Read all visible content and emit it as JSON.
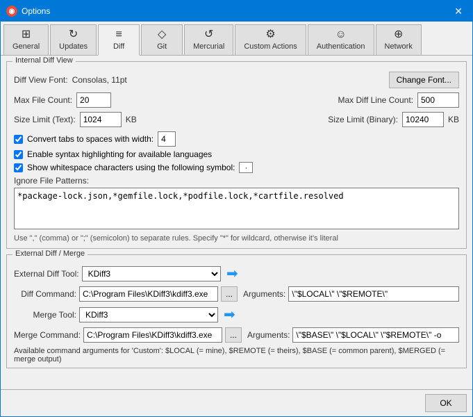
{
  "window": {
    "title": "Options",
    "icon": "◉",
    "close_label": "✕"
  },
  "tabs": [
    {
      "id": "general",
      "label": "General",
      "icon": "⊞",
      "active": false
    },
    {
      "id": "updates",
      "label": "Updates",
      "icon": "↻",
      "active": false
    },
    {
      "id": "diff",
      "label": "Diff",
      "icon": "≡",
      "active": true
    },
    {
      "id": "git",
      "label": "Git",
      "icon": "◇",
      "active": false
    },
    {
      "id": "mercurial",
      "label": "Mercurial",
      "icon": "↺",
      "active": false
    },
    {
      "id": "custom-actions",
      "label": "Custom Actions",
      "icon": "⚙",
      "active": false
    },
    {
      "id": "authentication",
      "label": "Authentication",
      "icon": "☺",
      "active": false
    },
    {
      "id": "network",
      "label": "Network",
      "icon": "⊕",
      "active": false
    }
  ],
  "internal_section": {
    "title": "Internal Diff View",
    "font_label": "Diff View Font:",
    "font_value": "Consolas, 11pt",
    "change_font_btn": "Change Font...",
    "max_file_count_label": "Max File Count:",
    "max_file_count_value": "20",
    "max_diff_line_label": "Max Diff Line Count:",
    "max_diff_line_value": "500",
    "size_limit_text_label": "Size Limit (Text):",
    "size_limit_text_value": "1024",
    "size_limit_text_unit": "KB",
    "size_limit_binary_label": "Size Limit (Binary):",
    "size_limit_binary_value": "10240",
    "size_limit_binary_unit": "KB",
    "cb1_label": "Convert tabs to spaces with width:",
    "cb1_checked": true,
    "cb1_value": "4",
    "cb2_label": "Enable syntax highlighting for available languages",
    "cb2_checked": true,
    "cb3_label": "Show whitespace characters using the following symbol:",
    "cb3_checked": true,
    "whitespace_symbol": "·",
    "ignore_label": "Ignore File Patterns:",
    "ignore_value": "*package-lock.json,*gemfile.lock,*podfile.lock,*cartfile.resolved",
    "hint": "Use \",\" (comma) or \";\" (semicolon) to separate rules. Specify \"*\" for wildcard, otherwise it's literal"
  },
  "external_section": {
    "title": "External Diff / Merge",
    "ext_diff_label": "External Diff Tool:",
    "ext_diff_value": "KDiff3",
    "diff_cmd_label": "Diff Command:",
    "diff_cmd_value": "C:\\Program Files\\KDiff3\\kdiff3.exe",
    "diff_args_label": "Arguments:",
    "diff_args_value": "\\\"$LOCAL\\\" \\\"$REMOTE\\\"",
    "merge_tool_label": "Merge Tool:",
    "merge_tool_value": "KDiff3",
    "merge_cmd_label": "Merge Command:",
    "merge_cmd_value": "C:\\Program Files\\KDiff3\\kdiff3.exe",
    "merge_args_label": "Arguments:",
    "merge_args_value": "\\\"$BASE\\\" \\\"$LOCAL\\\" \\\"$REMOTE\\\" -o",
    "browse_btn": "...",
    "note": "Available command arguments for 'Custom': $LOCAL (= mine), $REMOTE (= theirs), $BASE (= common parent),\n$MERGED (= merge output)"
  },
  "bottom": {
    "ok_label": "OK"
  }
}
